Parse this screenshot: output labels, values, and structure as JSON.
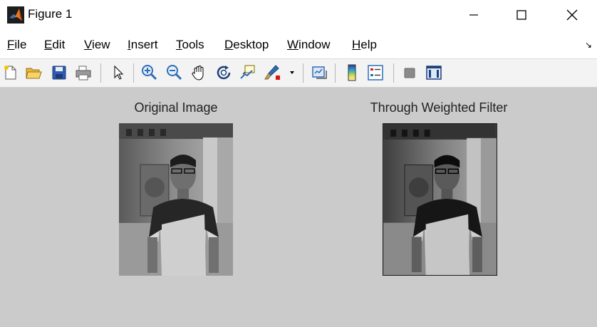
{
  "window": {
    "title": "Figure 1"
  },
  "menu": {
    "items": [
      {
        "key": "F",
        "rest": "ile"
      },
      {
        "key": "E",
        "rest": "dit"
      },
      {
        "key": "V",
        "rest": "iew"
      },
      {
        "key": "I",
        "rest": "nsert"
      },
      {
        "key": "T",
        "rest": "ools"
      },
      {
        "key": "D",
        "rest": "esktop"
      },
      {
        "key": "W",
        "rest": "indow"
      },
      {
        "key": "H",
        "rest": "elp"
      }
    ],
    "dock_glyph": "↘"
  },
  "toolbar": {
    "icons": [
      "new-figure-icon",
      "open-file-icon",
      "save-icon",
      "print-icon",
      "edit-plot-icon",
      "zoom-in-icon",
      "zoom-out-icon",
      "pan-icon",
      "rotate-3d-icon",
      "data-cursor-icon",
      "brush-icon",
      "link-plot-icon",
      "colorbar-icon",
      "legend-icon",
      "hide-plot-tools-icon",
      "show-plot-tools-icon"
    ]
  },
  "axes": [
    {
      "title": "Original Image"
    },
    {
      "title": "Through Weighted Filter"
    }
  ],
  "colors": {
    "canvas": "#cbcbcb",
    "toolbar": "#f3f3f3",
    "accent_orange": "#e8761c"
  }
}
